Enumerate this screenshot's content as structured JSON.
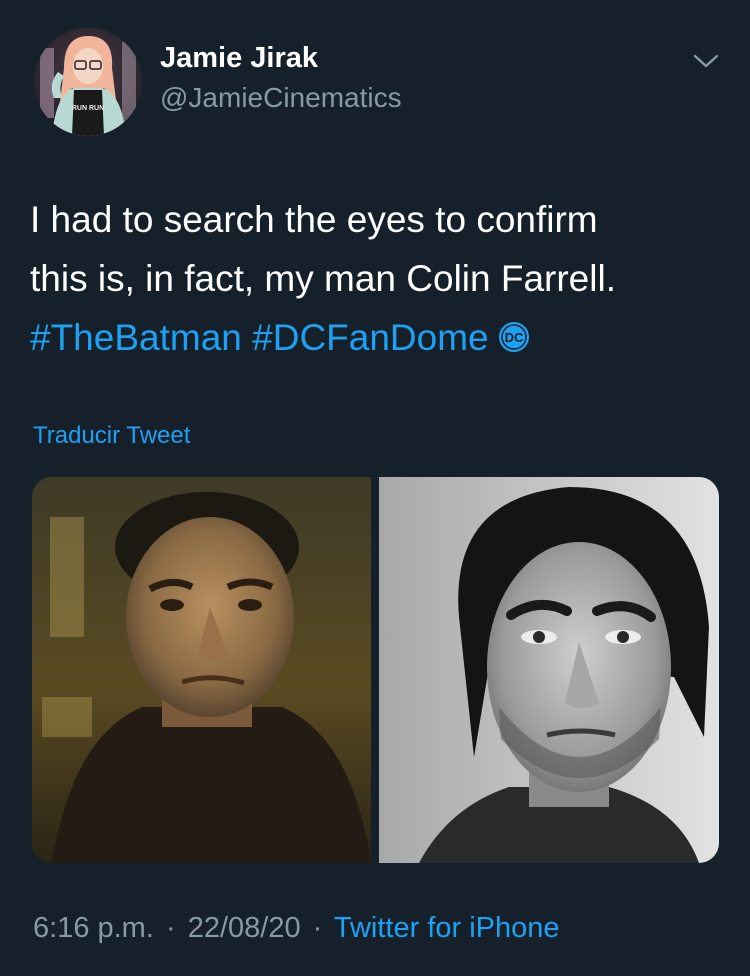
{
  "author": {
    "display_name": "Jamie Jirak",
    "handle": "@JamieCinematics",
    "avatar_shirt_text": "RUN RUN"
  },
  "menu_icon": "chevron-down-icon",
  "tweet": {
    "text_line1": "I had to search the eyes to confirm",
    "text_line2": "this is, in fact, my man Colin Farrell.",
    "hashtags": [
      "#TheBatman",
      "#DCFanDome"
    ],
    "emoji": "dc-logo-icon",
    "emoji_text": "DC"
  },
  "translate_label": "Traducir Tweet",
  "media": [
    {
      "description_icon": "penguin-character-photo"
    },
    {
      "description_icon": "colin-farrell-portrait-photo"
    }
  ],
  "meta": {
    "time": "6:16 p.m.",
    "separator": "·",
    "date": "22/08/20",
    "source": "Twitter for iPhone"
  },
  "colors": {
    "background": "#15202b",
    "link": "#1da1f2",
    "secondary_text": "#8899a6"
  }
}
